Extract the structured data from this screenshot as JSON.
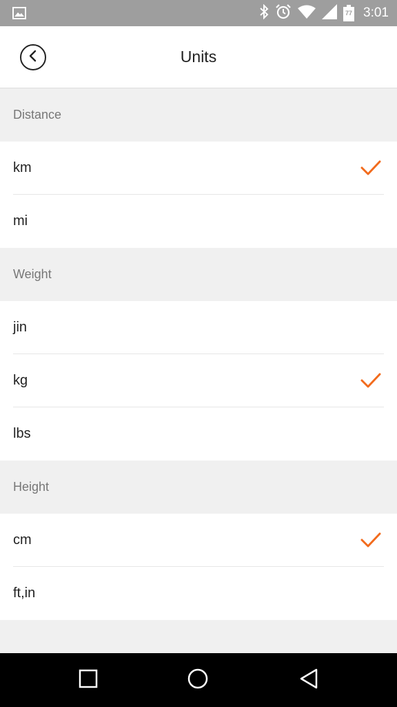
{
  "status_bar": {
    "time": "3:01",
    "battery_level": "77",
    "icons": [
      "image-notification-icon",
      "bluetooth-icon",
      "alarm-icon",
      "wifi-icon",
      "signal-icon",
      "battery-icon"
    ]
  },
  "header": {
    "title": "Units",
    "back_icon": "chevron-left-circle-icon"
  },
  "sections": [
    {
      "title": "Distance",
      "options": [
        {
          "label": "km",
          "selected": true
        },
        {
          "label": "mi",
          "selected": false
        }
      ]
    },
    {
      "title": "Weight",
      "options": [
        {
          "label": "jin",
          "selected": false
        },
        {
          "label": "kg",
          "selected": true
        },
        {
          "label": "lbs",
          "selected": false
        }
      ]
    },
    {
      "title": "Height",
      "options": [
        {
          "label": "cm",
          "selected": true
        },
        {
          "label": "ft,in",
          "selected": false
        }
      ]
    }
  ],
  "colors": {
    "accent": "#f26b1d",
    "status_bar": "#9e9e9e",
    "section_bg": "#f0f0f0",
    "nav_bar": "#000000"
  },
  "nav_bar": {
    "icons": [
      "recent-apps-icon",
      "home-icon",
      "back-icon"
    ]
  }
}
